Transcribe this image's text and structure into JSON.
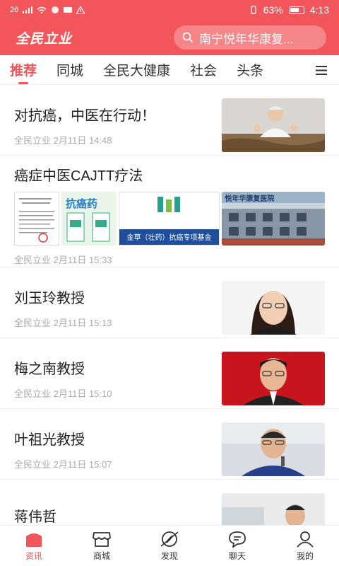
{
  "status": {
    "network": "26",
    "battery": "63%",
    "time": "4:13"
  },
  "header": {
    "logo": "全民立业",
    "search_text": "南宁悦年华康复..."
  },
  "tabs": [
    {
      "label": "推荐"
    },
    {
      "label": "同城"
    },
    {
      "label": "全民大健康"
    },
    {
      "label": "社会"
    },
    {
      "label": "头条"
    }
  ],
  "feed": [
    {
      "title": "对抗癌，中医在行动！",
      "meta": "全民立业 2月11日 14:48"
    },
    {
      "title": "癌症中医CAJTT疗法",
      "meta": "全民立业 2月11日 15:33",
      "image_captions": [
        "抗癌药",
        "金草（壮药）抗癌专项基金",
        "悦年华康复医院"
      ]
    },
    {
      "title": "刘玉玲教授",
      "meta": "全民立业 2月11日 15:13"
    },
    {
      "title": "梅之南教授",
      "meta": "全民立业 2月11日 15:10"
    },
    {
      "title": "叶祖光教授",
      "meta": "全民立业 2月11日 15:07"
    },
    {
      "title": "蒋伟哲",
      "meta": ""
    }
  ],
  "bottom_nav": [
    {
      "label": "资讯",
      "icon": "home-icon"
    },
    {
      "label": "商城",
      "icon": "shop-icon"
    },
    {
      "label": "发现",
      "icon": "compass-icon"
    },
    {
      "label": "聊天",
      "icon": "chat-icon"
    },
    {
      "label": "我的",
      "icon": "user-icon"
    }
  ],
  "colors": {
    "brand": "#f2565a",
    "meta": "#aaaaaa"
  }
}
